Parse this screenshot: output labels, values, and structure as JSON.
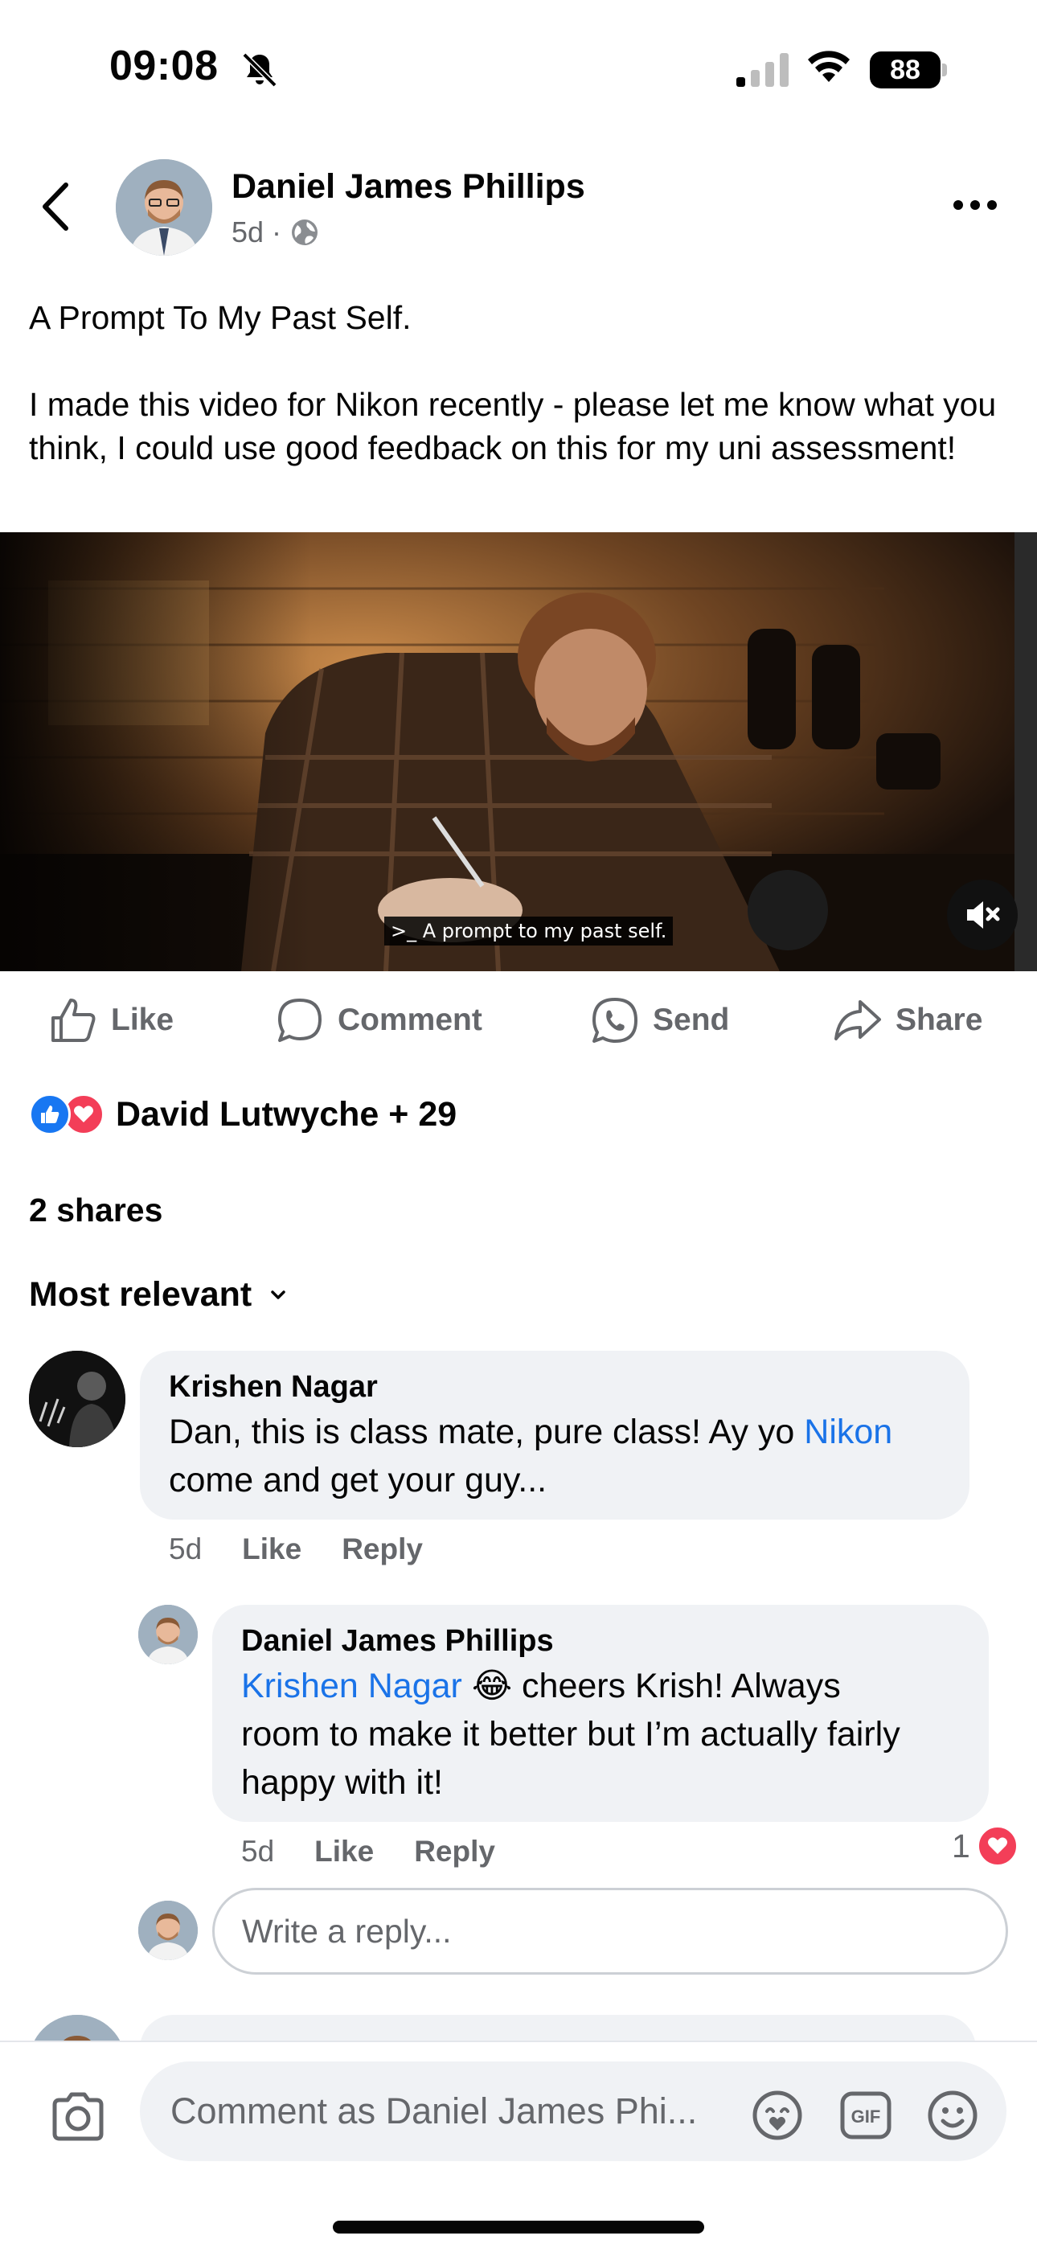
{
  "status_bar": {
    "time": "09:08",
    "battery": "88"
  },
  "post": {
    "author": "Daniel James Phillips",
    "age": "5d",
    "separator": "·",
    "text_title": "A Prompt To My Past Self.",
    "text_body": "I made this video for Nikon recently - please let me know what you think, I could use good feedback on this for my uni assessment!",
    "video_caption": ">_ A prompt to my past self."
  },
  "actions": {
    "like": "Like",
    "comment": "Comment",
    "send": "Send",
    "share": "Share"
  },
  "reactions": {
    "summary": "David Lutwyche + 29"
  },
  "shares": "2 shares",
  "sort": {
    "label": "Most relevant"
  },
  "comments": [
    {
      "author": "Krishen Nagar",
      "text_before": "Dan, this is class mate, pure class! Ay yo ",
      "mention": "Nikon",
      "text_after": "come and get your guy...",
      "age": "5d",
      "like": "Like",
      "reply": "Reply"
    }
  ],
  "replies": [
    {
      "author": "Daniel James Phillips",
      "mention": "Krishen Nagar",
      "emoji": "😂",
      "text_line1": " cheers Krish! Always",
      "text_line2": "room to make it better but I’m actually fairly",
      "text_line3": "happy with it!",
      "age": "5d",
      "like": "Like",
      "reply": "Reply",
      "reaction_count": "1"
    }
  ],
  "reply_input": {
    "placeholder": "Write a reply..."
  },
  "comment_bar": {
    "placeholder": "Comment as Daniel James Phi..."
  },
  "colors": {
    "link": "#1a73e8",
    "like_blue": "#1877f2",
    "love_red": "#f33e58",
    "secondary_text": "#65676b",
    "bubble_bg": "#f0f2f5"
  }
}
